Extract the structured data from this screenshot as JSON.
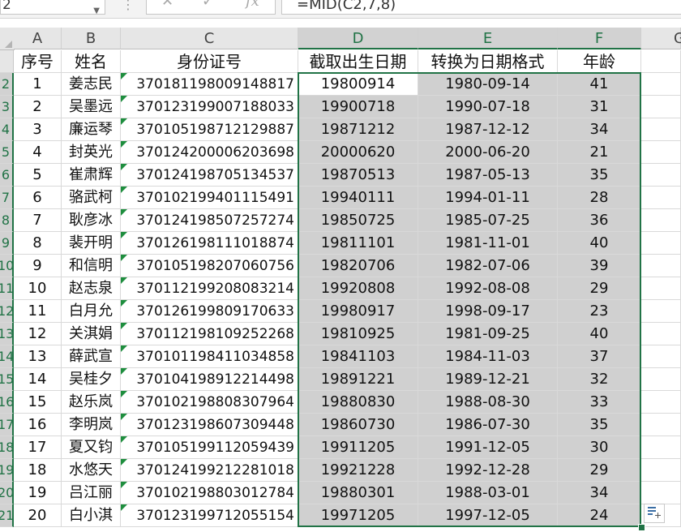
{
  "formula_bar": {
    "name_box": "2",
    "formula": "=MID(C2,7,8)"
  },
  "columns": [
    "A",
    "B",
    "C",
    "D",
    "E",
    "F"
  ],
  "edge_column": "G",
  "header": [
    "序号",
    "姓名",
    "身份证号",
    "截取出生日期",
    "转换为日期格式",
    "年龄"
  ],
  "rows": [
    {
      "rownum": "2",
      "no": "1",
      "name": "姜志民",
      "id": "370181198009148817",
      "birth": "19800914",
      "date": "1980-09-14",
      "age": "41"
    },
    {
      "rownum": "3",
      "no": "2",
      "name": "吴墨远",
      "id": "370123199007188033",
      "birth": "19900718",
      "date": "1990-07-18",
      "age": "31"
    },
    {
      "rownum": "4",
      "no": "3",
      "name": "廉运琴",
      "id": "370105198712129887",
      "birth": "19871212",
      "date": "1987-12-12",
      "age": "34"
    },
    {
      "rownum": "5",
      "no": "4",
      "name": "封英光",
      "id": "370124200006203698",
      "birth": "20000620",
      "date": "2000-06-20",
      "age": "21"
    },
    {
      "rownum": "6",
      "no": "5",
      "name": "崔肃辉",
      "id": "370124198705134537",
      "birth": "19870513",
      "date": "1987-05-13",
      "age": "35"
    },
    {
      "rownum": "7",
      "no": "6",
      "name": "骆武柯",
      "id": "370102199401115491",
      "birth": "19940111",
      "date": "1994-01-11",
      "age": "28"
    },
    {
      "rownum": "8",
      "no": "7",
      "name": "耿彦冰",
      "id": "370124198507257274",
      "birth": "19850725",
      "date": "1985-07-25",
      "age": "36"
    },
    {
      "rownum": "9",
      "no": "8",
      "name": "裴开明",
      "id": "370126198111018874",
      "birth": "19811101",
      "date": "1981-11-01",
      "age": "40"
    },
    {
      "rownum": "10",
      "no": "9",
      "name": "和信明",
      "id": "370105198207060756",
      "birth": "19820706",
      "date": "1982-07-06",
      "age": "39"
    },
    {
      "rownum": "11",
      "no": "10",
      "name": "赵志泉",
      "id": "370112199208083214",
      "birth": "19920808",
      "date": "1992-08-08",
      "age": "29"
    },
    {
      "rownum": "12",
      "no": "11",
      "name": "白月允",
      "id": "370126199809170633",
      "birth": "19980917",
      "date": "1998-09-17",
      "age": "23"
    },
    {
      "rownum": "13",
      "no": "12",
      "name": "关淇娟",
      "id": "370112198109252268",
      "birth": "19810925",
      "date": "1981-09-25",
      "age": "40"
    },
    {
      "rownum": "14",
      "no": "13",
      "name": "薛武宣",
      "id": "370101198411034858",
      "birth": "19841103",
      "date": "1984-11-03",
      "age": "37"
    },
    {
      "rownum": "15",
      "no": "14",
      "name": "吴桂夕",
      "id": "370104198912214498",
      "birth": "19891221",
      "date": "1989-12-21",
      "age": "32"
    },
    {
      "rownum": "16",
      "no": "15",
      "name": "赵乐岚",
      "id": "370102198808307964",
      "birth": "19880830",
      "date": "1988-08-30",
      "age": "33"
    },
    {
      "rownum": "17",
      "no": "16",
      "name": "李明岚",
      "id": "370123198607309448",
      "birth": "19860730",
      "date": "1986-07-30",
      "age": "35"
    },
    {
      "rownum": "18",
      "no": "17",
      "name": "夏又钧",
      "id": "370105199112059439",
      "birth": "19911205",
      "date": "1991-12-05",
      "age": "30"
    },
    {
      "rownum": "19",
      "no": "18",
      "name": "水悠天",
      "id": "370124199212281018",
      "birth": "19921228",
      "date": "1992-12-28",
      "age": "29"
    },
    {
      "rownum": "20",
      "no": "19",
      "name": "吕江丽",
      "id": "370102198803012784",
      "birth": "19880301",
      "date": "1988-03-01",
      "age": "34"
    },
    {
      "rownum": "21",
      "no": "20",
      "name": "白小淇",
      "id": "370123199712055154",
      "birth": "19971205",
      "date": "1997-12-05",
      "age": "24"
    }
  ],
  "icons": {
    "cancel": "close-icon",
    "enter": "checkmark-icon",
    "function": "fx-icon",
    "quick_analysis": "quick-analysis-icon"
  },
  "colors": {
    "selection_border": "#217346",
    "selection_fill": "#d0d0d0",
    "error_triangle": "#1e8e3e"
  }
}
